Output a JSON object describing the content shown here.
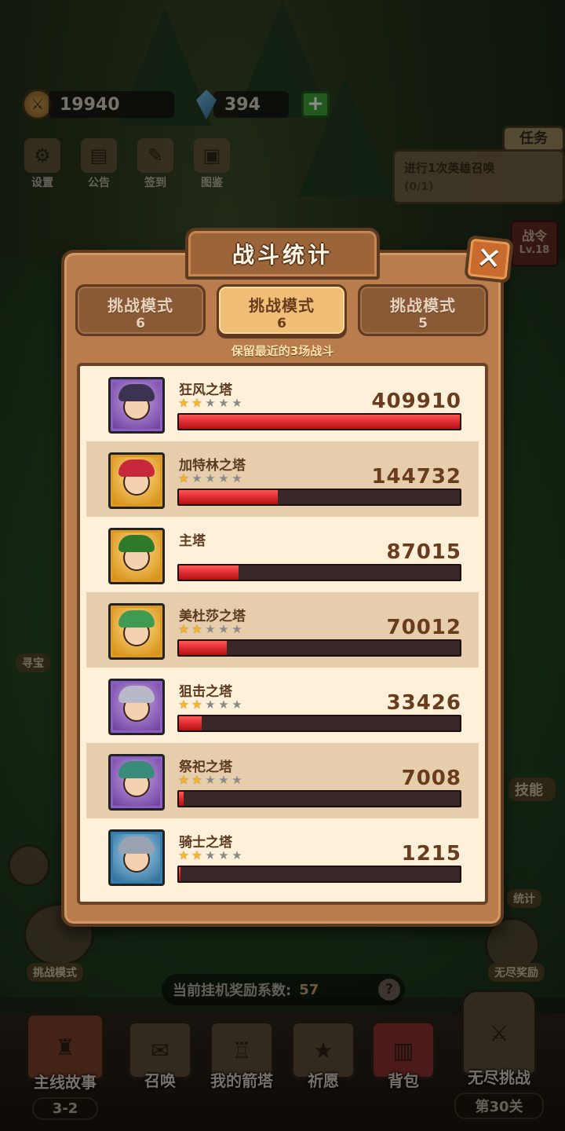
{
  "resources": {
    "gold": "19940",
    "gems": "394"
  },
  "top_menu": [
    "设置",
    "公告",
    "签到",
    "图鉴"
  ],
  "task": {
    "tag": "任务",
    "text": "进行1次英雄召唤",
    "progress": "(0/1)"
  },
  "battle_pass": {
    "label": "战令",
    "level": "Lv.18"
  },
  "dialog": {
    "title": "战斗统计",
    "close_icon": "close-x-icon",
    "tabs": [
      {
        "label": "挑战模式",
        "count": "6",
        "active": false
      },
      {
        "label": "挑战模式",
        "count": "6",
        "active": true
      },
      {
        "label": "挑战模式",
        "count": "5",
        "active": false
      }
    ],
    "hint": "保留最近的3场战斗"
  },
  "stats": {
    "max_damage": 409910,
    "rows": [
      {
        "name": "狂风之塔",
        "stars": 2,
        "damage": "409910",
        "value": 409910,
        "frame": "purple"
      },
      {
        "name": "加特林之塔",
        "stars": 1,
        "damage": "144732",
        "value": 144732,
        "frame": "gold"
      },
      {
        "name": "主塔",
        "stars": 0,
        "damage": "87015",
        "value": 87015,
        "frame": "gold"
      },
      {
        "name": "美杜莎之塔",
        "stars": 2,
        "damage": "70012",
        "value": 70012,
        "frame": "gold"
      },
      {
        "name": "狙击之塔",
        "stars": 2,
        "damage": "33426",
        "value": 33426,
        "frame": "purple"
      },
      {
        "name": "祭祀之塔",
        "stars": 2,
        "damage": "7008",
        "value": 7008,
        "frame": "purple"
      },
      {
        "name": "骑士之塔",
        "stars": 2,
        "damage": "1215",
        "value": 1215,
        "frame": "blue"
      }
    ]
  },
  "side": {
    "treasure": "寻宝",
    "challenge": "挑战模式",
    "skill": "技能",
    "stats": "统计",
    "endless_reward": "无尽奖励"
  },
  "reward": {
    "label": "当前挂机奖励系数:",
    "value": "57",
    "help": "?"
  },
  "bottom_nav": {
    "story": {
      "label": "主线故事",
      "sub": "3-2"
    },
    "summon": "召唤",
    "tower": "我的箭塔",
    "wish": "祈愿",
    "bag": "背包",
    "endless": {
      "label": "无尽挑战",
      "sub": "第30关"
    }
  }
}
